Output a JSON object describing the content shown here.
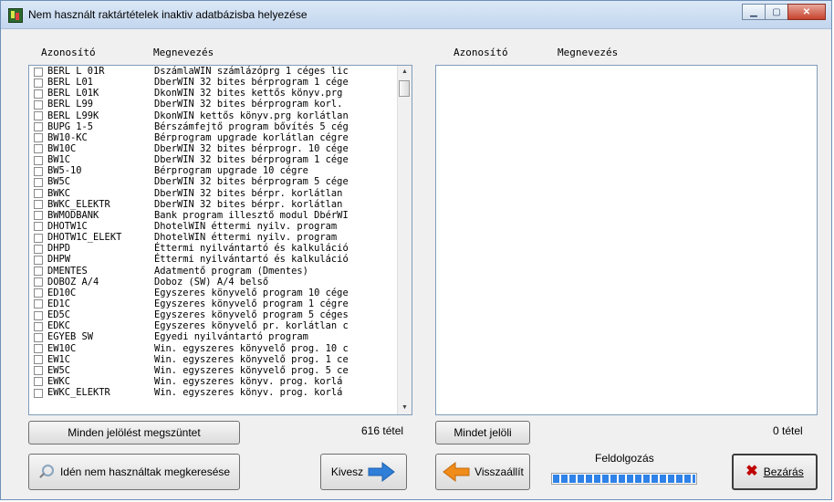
{
  "window": {
    "title": "Nem használt raktártételek inaktiv adatbázisba helyezése",
    "icon": "app-icon",
    "controls": {
      "minimize": "minimize-icon",
      "maximize": "maximize-icon",
      "close": "close-icon"
    }
  },
  "left_panel": {
    "col_code": "Azonosító",
    "col_name": "Megnevezés",
    "items": [
      {
        "code": "BERL L 01R",
        "name": "DszámlaWIN számlázóprg 1 céges lic"
      },
      {
        "code": "BERL L01",
        "name": "DberWIN 32 bites bérprogram 1 cége"
      },
      {
        "code": "BERL L01K",
        "name": "DkonWIN 32 bites kettős könyv.prg"
      },
      {
        "code": "BERL L99",
        "name": "DberWIN 32 bites bérprogram korl."
      },
      {
        "code": "BERL L99K",
        "name": "DkonWIN kettős könyv.prg korlátlan"
      },
      {
        "code": "BUPG 1-5",
        "name": "Bérszámfejtő program bővítés 5 cég"
      },
      {
        "code": "BW10-KC",
        "name": "Bérprogram upgrade korlátlan cégre"
      },
      {
        "code": "BW10C",
        "name": "DberWIN 32 bites bérprogr. 10 cége"
      },
      {
        "code": "BW1C",
        "name": "DberWIN 32 bites bérprogram 1 cége"
      },
      {
        "code": "BW5-10",
        "name": "Bérprogram upgrade 10 cégre"
      },
      {
        "code": "BW5C",
        "name": "DberWIN 32 bites bérprogram 5 cége"
      },
      {
        "code": "BWKC",
        "name": "DberWIN 32 bites bérpr. korlátlan"
      },
      {
        "code": "BWKC_ELEKTR",
        "name": "DberWIN 32 bites bérpr. korlátlan"
      },
      {
        "code": "BWMODBANK",
        "name": "Bank program illesztő modul DbérWI"
      },
      {
        "code": "DHOTW1C",
        "name": "DhotelWIN éttermi nyilv. program"
      },
      {
        "code": "DHOTW1C_ELEKT",
        "name": "DhotelWIN éttermi nyilv. program"
      },
      {
        "code": "DHPD",
        "name": "Éttermi nyilvántartó és kalkuláció"
      },
      {
        "code": "DHPW",
        "name": "Éttermi nyilvántartó és kalkuláció"
      },
      {
        "code": "DMENTES",
        "name": "Adatmentő program (Dmentes)"
      },
      {
        "code": "DOBOZ A/4",
        "name": "Doboz (SW) A/4 belső"
      },
      {
        "code": "ED10C",
        "name": "Egyszeres könyvelő program 10 cége"
      },
      {
        "code": "ED1C",
        "name": "Egyszeres könyvelő program 1 cégre"
      },
      {
        "code": "ED5C",
        "name": "Egyszeres könyvelő program 5 céges"
      },
      {
        "code": "EDKC",
        "name": "Egyszeres könyvelő pr. korlátlan c"
      },
      {
        "code": "EGYEB SW",
        "name": "Egyedi nyilvántartó program"
      },
      {
        "code": "EW10C",
        "name": "Win. egyszeres könyvelő prog. 10 c"
      },
      {
        "code": "EW1C",
        "name": "Win. egyszeres könyvelő prog. 1 ce"
      },
      {
        "code": "EW5C",
        "name": "Win. egyszeres könyvelő prog. 5 ce"
      },
      {
        "code": "EWKC",
        "name": "Win. egyszeres könyv. prog. korlá"
      },
      {
        "code": "EWKC_ELEKTR",
        "name": "Win. egyszeres könyv. prog. korlá"
      }
    ],
    "count_label": "616 tétel"
  },
  "right_panel": {
    "col_code": "Azonosító",
    "col_name": "Megnevezés",
    "count_label": "0 tétel"
  },
  "buttons": {
    "clear_all": "Minden jelölést megszüntet",
    "select_all": "Mindet jelöli",
    "search_unused": "Idén nem használtak megkeresése",
    "export": "Kivesz",
    "restore": "Visszaállít",
    "close": "Bezárás"
  },
  "progress": {
    "label": "Feldolgozás",
    "value": 1.0
  },
  "colors": {
    "accent": "#2e82e8",
    "arrow_blue": "#2f7fd8",
    "arrow_orange": "#f08c1a",
    "close_x": "#c00000"
  }
}
